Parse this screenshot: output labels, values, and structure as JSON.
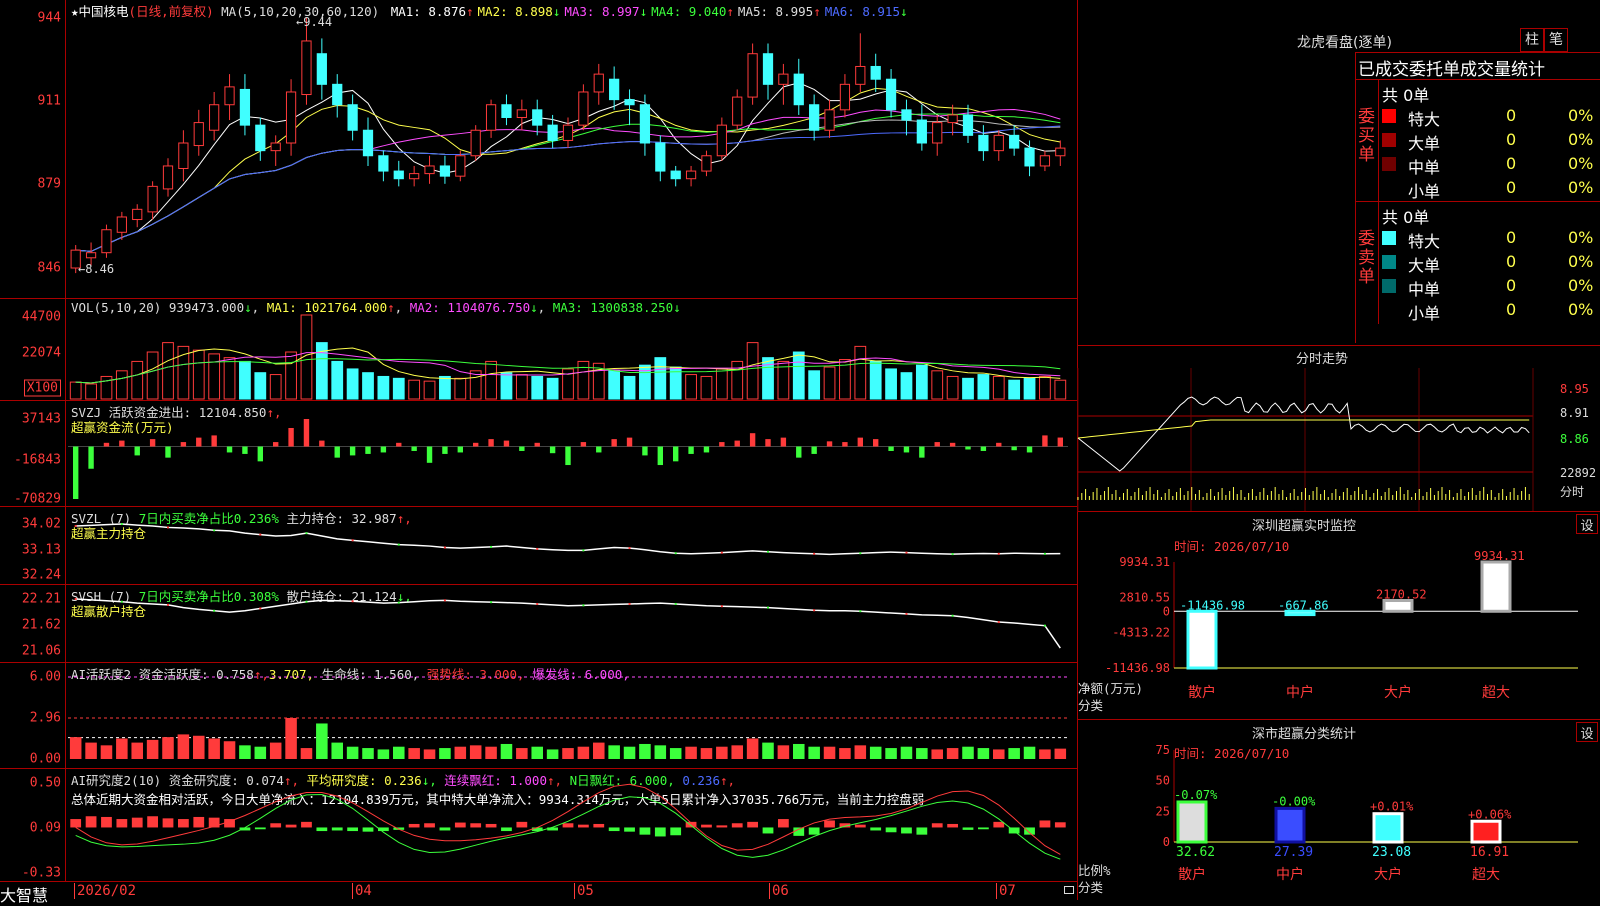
{
  "app_logo": "大智慧",
  "stock": {
    "star": "★",
    "name": "中国核电",
    "mode": "(日线,前复权)"
  },
  "main_panel": {
    "ma_title": "MA(5,10,20,30,60,120)",
    "ma_items": [
      {
        "label": "MA1:",
        "value": "8.876",
        "arrow": "↑",
        "color": "#ffffff"
      },
      {
        "label": "MA2:",
        "value": "8.898",
        "arrow": "↓",
        "color": "#ffff4d"
      },
      {
        "label": "MA3:",
        "value": "8.997",
        "arrow": "↓",
        "color": "#ff4dff"
      },
      {
        "label": "MA4:",
        "value": "9.040",
        "arrow": "↑",
        "color": "#3cff3c"
      },
      {
        "label": "MA5:",
        "value": "8.995",
        "arrow": "↑",
        "color": "#dddddd"
      },
      {
        "label": "MA6:",
        "value": "8.915",
        "arrow": "↓",
        "color": "#4d6bff"
      }
    ],
    "y_ticks": [
      "944",
      "911",
      "879",
      "846"
    ],
    "high_marker": "9.44",
    "low_marker": "8.46"
  },
  "vol_panel": {
    "title": "VOL(5,10,20)",
    "value": "939473.000",
    "value_arrow": "↓",
    "ma1": "MA1: 1021764.000",
    "ma1_arrow": "↑",
    "ma2": "MA2: 1104076.750",
    "ma2_arrow": "↓",
    "ma3": "MA3: 1300838.250",
    "ma3_arrow": "↓",
    "y_ticks": [
      "44700",
      "22074",
      "X100"
    ]
  },
  "svzj_panel": {
    "title": "SVZJ",
    "label": "活跃资金进出:",
    "value": "12104.850",
    "arrow": "↑,",
    "sub": "超赢资金流(万元)",
    "y_ticks": [
      "37143",
      "-16843",
      "-70829"
    ]
  },
  "svzl_panel": {
    "title": "SVZL (7)",
    "ratio_label": "7日内买卖净占比0.236%",
    "hold_label": "主力持仓:",
    "hold_value": "32.987",
    "arrow": "↑,",
    "sub": "超赢主力持仓",
    "y_ticks": [
      "34.02",
      "33.13",
      "32.24"
    ]
  },
  "svsh_panel": {
    "title": "SVSH (7)",
    "ratio_label": "7日内买卖净占比0.308%",
    "hold_label": "散户持仓:",
    "hold_value": "21.124",
    "arrow": "↓,",
    "sub": "超赢散户持仓",
    "y_ticks": [
      "22.21",
      "21.62",
      "21.06"
    ]
  },
  "ai_active_panel": {
    "title": "AI活跃度2",
    "label": "资金活跃度:",
    "value": "0.758",
    "arrow": "↑,",
    "v2": "3.707,",
    "life": "生命线: 1.560,",
    "strong": "强势线: 3.000,",
    "burst": "爆发线: 6.000,",
    "y_ticks": [
      "6.00",
      "2.96",
      "0.00"
    ]
  },
  "ai_research_panel": {
    "title": "AI研究度2(10)",
    "label": "资金研究度:",
    "value": "0.074",
    "arrow": "↑,",
    "avg": "平均研究度: 0.236",
    "avg_arrow": "↓,",
    "red_cnt": "连续飘红: 1.000",
    "red_arrow": "↑,",
    "nday": "N日飘红: 6.000,",
    "last": "0.236",
    "last_arrow": "↑,",
    "summary": "总体近期大资金相对活跃，今日大单净流入：12104.839万元，其中特大单净流入：9934.314万元，大单5日累计净入37035.766万元，当前主力控盘弱",
    "y_ticks": [
      "0.50",
      "0.09",
      "-0.33"
    ]
  },
  "x_axis": [
    "2026/02",
    "04",
    "05",
    "06",
    "07"
  ],
  "longhu": {
    "title": "龙虎看盘(逐单)",
    "btn1": "柱",
    "btn2": "笔",
    "subtitle": "已成交委托单成交量统计",
    "buy_label": "委买单",
    "sell_label": "委卖单",
    "buy_total": "共 0单",
    "sell_total": "共 0单",
    "buy_rows": [
      {
        "name": "特大",
        "count": "0",
        "pct": "0%",
        "color": "#ff0000"
      },
      {
        "name": "大单",
        "count": "0",
        "pct": "0%",
        "color": "#a00000"
      },
      {
        "name": "中单",
        "count": "0",
        "pct": "0%",
        "color": "#700000"
      },
      {
        "name": "小单",
        "count": "0",
        "pct": "0%",
        "color": "#000000"
      }
    ],
    "sell_rows": [
      {
        "name": "特大",
        "count": "0",
        "pct": "0%",
        "color": "#40ffff"
      },
      {
        "name": "大单",
        "count": "0",
        "pct": "0%",
        "color": "#008888"
      },
      {
        "name": "中单",
        "count": "0",
        "pct": "0%",
        "color": "#006a6a"
      },
      {
        "name": "小单",
        "count": "0",
        "pct": "0%",
        "color": "#000000"
      }
    ]
  },
  "intraday": {
    "title": "分时走势",
    "y_ticks": [
      "8.95",
      "8.91",
      "8.86"
    ],
    "vol_max": "22892",
    "vol_unit": "分时"
  },
  "monitor": {
    "title": "深圳超赢实时监控",
    "btn": "设",
    "time": "时间: 2026/07/10",
    "y_ticks": [
      "9934.31",
      "2810.55",
      "0",
      "-4313.22",
      "-11436.98"
    ],
    "unit": "净额(万元)",
    "cat_label": "分类",
    "categories": [
      "散户",
      "中户",
      "大户",
      "超大"
    ]
  },
  "classify": {
    "title": "深市超赢分类统计",
    "btn": "设",
    "time": "时间: 2026/07/10",
    "y_ticks": [
      "75",
      "50",
      "25",
      "0"
    ],
    "unit": "比例%",
    "cat_label": "分类",
    "categories": [
      "散户",
      "中户",
      "大户",
      "超大"
    ]
  },
  "chart_data": [
    {
      "type": "candlestick",
      "title": "中国核电 (日线,前复权)",
      "ylim": [
        8.46,
        9.44
      ],
      "y_ticks": [
        9.44,
        9.11,
        8.79,
        8.46
      ],
      "x_ticks": [
        "2026/02",
        "04",
        "05",
        "06",
        "07"
      ],
      "ohlc": [
        [
          8.46,
          8.55,
          8.44,
          8.53
        ],
        [
          8.5,
          8.56,
          8.47,
          8.52
        ],
        [
          8.52,
          8.63,
          8.5,
          8.61
        ],
        [
          8.6,
          8.68,
          8.57,
          8.66
        ],
        [
          8.65,
          8.71,
          8.62,
          8.69
        ],
        [
          8.68,
          8.8,
          8.65,
          8.78
        ],
        [
          8.77,
          8.89,
          8.74,
          8.86
        ],
        [
          8.85,
          9.0,
          8.8,
          8.95
        ],
        [
          8.94,
          9.08,
          8.9,
          9.03
        ],
        [
          9.0,
          9.15,
          8.96,
          9.1
        ],
        [
          9.1,
          9.22,
          9.04,
          9.17
        ],
        [
          9.16,
          9.22,
          8.98,
          9.02
        ],
        [
          9.02,
          9.05,
          8.88,
          8.92
        ],
        [
          8.92,
          8.98,
          8.86,
          8.95
        ],
        [
          8.95,
          9.2,
          8.9,
          9.15
        ],
        [
          9.14,
          9.44,
          9.1,
          9.35
        ],
        [
          9.3,
          9.36,
          9.12,
          9.18
        ],
        [
          9.18,
          9.22,
          9.05,
          9.1
        ],
        [
          9.1,
          9.14,
          8.96,
          9.0
        ],
        [
          9.0,
          9.05,
          8.86,
          8.9
        ],
        [
          8.9,
          8.92,
          8.8,
          8.84
        ],
        [
          8.84,
          8.88,
          8.78,
          8.81
        ],
        [
          8.81,
          8.86,
          8.78,
          8.83
        ],
        [
          8.83,
          8.9,
          8.79,
          8.86
        ],
        [
          8.86,
          8.9,
          8.79,
          8.82
        ],
        [
          8.82,
          8.92,
          8.8,
          8.9
        ],
        [
          8.9,
          9.02,
          8.88,
          9.0
        ],
        [
          9.0,
          9.12,
          8.97,
          9.1
        ],
        [
          9.1,
          9.14,
          9.02,
          9.05
        ],
        [
          9.05,
          9.12,
          9.0,
          9.08
        ],
        [
          9.08,
          9.12,
          8.98,
          9.02
        ],
        [
          9.02,
          9.06,
          8.93,
          8.96
        ],
        [
          8.96,
          9.05,
          8.93,
          9.02
        ],
        [
          9.02,
          9.18,
          9.0,
          9.15
        ],
        [
          9.15,
          9.26,
          9.1,
          9.22
        ],
        [
          9.2,
          9.25,
          9.08,
          9.12
        ],
        [
          9.12,
          9.16,
          9.02,
          9.1
        ],
        [
          9.1,
          9.14,
          8.9,
          8.95
        ],
        [
          8.95,
          8.98,
          8.8,
          8.84
        ],
        [
          8.84,
          8.86,
          8.78,
          8.81
        ],
        [
          8.81,
          8.86,
          8.78,
          8.84
        ],
        [
          8.84,
          8.92,
          8.82,
          8.9
        ],
        [
          8.9,
          9.05,
          8.88,
          9.02
        ],
        [
          9.02,
          9.16,
          9.0,
          9.13
        ],
        [
          9.13,
          9.34,
          9.1,
          9.3
        ],
        [
          9.3,
          9.34,
          9.12,
          9.18
        ],
        [
          9.18,
          9.26,
          9.1,
          9.22
        ],
        [
          9.22,
          9.28,
          9.06,
          9.1
        ],
        [
          9.1,
          9.14,
          8.96,
          9.0
        ],
        [
          9.0,
          9.12,
          8.97,
          9.08
        ],
        [
          9.08,
          9.22,
          9.05,
          9.18
        ],
        [
          9.18,
          9.38,
          9.15,
          9.25
        ],
        [
          9.25,
          9.3,
          9.15,
          9.2
        ],
        [
          9.2,
          9.24,
          9.05,
          9.08
        ],
        [
          9.08,
          9.12,
          8.98,
          9.04
        ],
        [
          9.04,
          9.1,
          8.92,
          8.95
        ],
        [
          8.95,
          9.06,
          8.9,
          9.03
        ],
        [
          9.03,
          9.1,
          8.98,
          9.06
        ],
        [
          9.06,
          9.1,
          8.95,
          8.98
        ],
        [
          8.98,
          9.02,
          8.88,
          8.92
        ],
        [
          8.92,
          9.0,
          8.88,
          8.98
        ],
        [
          8.98,
          9.02,
          8.9,
          8.93
        ],
        [
          8.93,
          8.96,
          8.82,
          8.86
        ],
        [
          8.86,
          8.92,
          8.84,
          8.9
        ],
        [
          8.9,
          8.96,
          8.86,
          8.93
        ]
      ]
    },
    {
      "type": "bar",
      "title": "VOL(5,10,20)",
      "ylim": [
        0,
        44700
      ],
      "y_ticks": [
        44700,
        22074
      ],
      "unit": "X100",
      "values": [
        9000,
        8000,
        12000,
        15000,
        20000,
        25000,
        30000,
        28000,
        26000,
        24000,
        22000,
        20000,
        14000,
        13000,
        25000,
        44700,
        30000,
        20000,
        16000,
        14000,
        12000,
        11000,
        10000,
        9500,
        12000,
        11000,
        15000,
        20000,
        14000,
        13000,
        12000,
        11000,
        16000,
        20000,
        19000,
        15000,
        12000,
        18000,
        22000,
        17000,
        13000,
        12000,
        16000,
        20000,
        30000,
        22000,
        20000,
        25000,
        15000,
        17000,
        21000,
        28000,
        20000,
        16000,
        14000,
        18000,
        15000,
        12000,
        11000,
        13000,
        12000,
        10000,
        11000,
        12000,
        10000
      ]
    },
    {
      "type": "bar",
      "title": "SVZJ 活跃资金进出",
      "ylim": [
        -70829,
        37143
      ],
      "y_ticks": [
        37143,
        -16843,
        -70829
      ],
      "ylabel": "超赢资金流(万元)",
      "values": [
        -70829,
        -30000,
        5000,
        8000,
        -12000,
        10000,
        -15000,
        6000,
        12000,
        15000,
        -8000,
        -10000,
        -20000,
        6000,
        25000,
        37143,
        8000,
        -15000,
        -12000,
        -10000,
        -8000,
        5000,
        -6000,
        -22000,
        -10000,
        -8000,
        5000,
        10000,
        8000,
        -6000,
        5000,
        -9000,
        -25000,
        6000,
        -8000,
        10000,
        12000,
        -12000,
        -25000,
        -20000,
        -10000,
        -8000,
        6000,
        8000,
        18000,
        10000,
        12000,
        -15000,
        -10000,
        7000,
        6000,
        12000,
        10000,
        -6000,
        -8000,
        -15000,
        6000,
        5000,
        -4000,
        -6000,
        5000,
        -5000,
        -8000,
        15000,
        12104
      ]
    },
    {
      "type": "line",
      "title": "SVZL 主力持仓",
      "ylim": [
        32.24,
        34.02
      ],
      "y_ticks": [
        34.02,
        33.13,
        32.24
      ],
      "ylabel": "超赢主力持仓",
      "values": [
        33.95,
        33.97,
        34.0,
        34.02,
        33.98,
        33.95,
        33.9,
        33.88,
        33.85,
        33.8,
        33.78,
        33.7,
        33.65,
        33.6,
        33.62,
        33.7,
        33.6,
        33.5,
        33.45,
        33.4,
        33.35,
        33.3,
        33.28,
        33.25,
        33.2,
        33.18,
        33.2,
        33.22,
        33.25,
        33.2,
        33.15,
        33.12,
        33.1,
        33.1,
        33.15,
        33.2,
        33.18,
        33.12,
        33.05,
        33.0,
        32.98,
        33.0,
        33.02,
        33.05,
        33.08,
        33.05,
        33.02,
        33.0,
        32.98,
        32.96,
        32.98,
        33.0,
        33.02,
        33.04,
        33.02,
        33.0,
        32.98,
        32.97,
        32.98,
        32.99,
        32.98,
        33.0,
        32.99,
        32.98,
        32.987
      ]
    },
    {
      "type": "line",
      "title": "SVSH 散户持仓",
      "ylim": [
        21.06,
        22.21
      ],
      "y_ticks": [
        22.21,
        21.62,
        21.06
      ],
      "ylabel": "超赢散户持仓",
      "values": [
        22.21,
        22.19,
        22.17,
        22.15,
        22.12,
        22.1,
        22.08,
        22.02,
        21.98,
        21.95,
        21.92,
        21.95,
        22.0,
        22.05,
        22.1,
        22.15,
        22.18,
        22.17,
        22.16,
        22.14,
        22.12,
        22.13,
        22.15,
        22.17,
        22.18,
        22.16,
        22.15,
        22.14,
        22.13,
        22.12,
        22.1,
        22.08,
        22.06,
        22.07,
        22.08,
        22.09,
        22.1,
        22.11,
        22.12,
        22.1,
        22.08,
        22.06,
        22.05,
        22.04,
        22.03,
        22.02,
        22.0,
        21.98,
        21.96,
        21.95,
        21.95,
        21.94,
        21.92,
        21.9,
        21.88,
        21.86,
        21.85,
        21.84,
        21.8,
        21.75,
        21.7,
        21.68,
        21.65,
        21.62,
        21.124
      ]
    },
    {
      "type": "bar",
      "title": "AI活跃度2",
      "ylim": [
        0,
        6
      ],
      "y_ticks": [
        6.0,
        2.96,
        0.0
      ],
      "reference_lines": {
        "生命线": 1.56,
        "强势线": 3.0,
        "爆发线": 6.0
      },
      "values": [
        1.6,
        1.2,
        1.0,
        1.5,
        1.2,
        1.4,
        1.6,
        1.8,
        1.7,
        1.5,
        1.3,
        1.0,
        0.9,
        1.2,
        3.0,
        0.8,
        2.6,
        1.2,
        0.9,
        0.8,
        0.7,
        0.9,
        0.8,
        0.7,
        0.8,
        0.9,
        1.0,
        0.9,
        1.1,
        0.8,
        0.9,
        0.7,
        0.8,
        0.9,
        1.2,
        1.0,
        0.9,
        1.1,
        1.0,
        0.8,
        0.9,
        0.8,
        0.9,
        1.0,
        1.5,
        1.2,
        1.0,
        1.1,
        0.9,
        0.9,
        0.8,
        1.0,
        0.9,
        0.8,
        0.9,
        0.8,
        0.7,
        0.8,
        0.9,
        0.8,
        0.7,
        0.8,
        0.9,
        0.7,
        0.758
      ]
    },
    {
      "type": "bar",
      "title": "AI研究度2(10)",
      "ylim": [
        -0.33,
        0.5
      ],
      "y_ticks": [
        0.5,
        0.09,
        -0.33
      ],
      "values": [
        0.12,
        0.16,
        0.15,
        0.12,
        0.14,
        0.16,
        0.13,
        0.12,
        0.15,
        0.14,
        0.12,
        0.05,
        0.03,
        0.06,
        0.04,
        0.08,
        0.06,
        0.05,
        0.06,
        0.07,
        0.06,
        0.04,
        0.05,
        0.06,
        0.05,
        0.07,
        0.06,
        0.05,
        0.06,
        0.08,
        0.06,
        0.05,
        0.06,
        0.04,
        0.05,
        0.06,
        0.07,
        0.12,
        0.15,
        0.13,
        0.08,
        0.04,
        0.03,
        0.06,
        0.08,
        0.1,
        0.12,
        0.14,
        0.12,
        0.1,
        0.06,
        0.04,
        0.05,
        0.08,
        0.1,
        0.12,
        0.06,
        0.05,
        0.04,
        0.03,
        0.08,
        0.1,
        0.12,
        0.1,
        0.074
      ]
    },
    {
      "type": "bar",
      "title": "深圳超赢实时监控",
      "categories": [
        "散户",
        "中户",
        "大户",
        "超大"
      ],
      "values": [
        -11436.98,
        -667.86,
        2170.52,
        9934.31
      ],
      "ylim": [
        -11436.98,
        9934.31
      ],
      "y_ticks": [
        9934.31,
        2810.55,
        0,
        -4313.22,
        -11436.98
      ],
      "ylabel": "净额(万元)",
      "xlabel": "分类"
    },
    {
      "type": "bar",
      "title": "深市超赢分类统计",
      "categories": [
        "散户",
        "中户",
        "大户",
        "超大"
      ],
      "values": [
        32.62,
        27.39,
        23.08,
        16.91
      ],
      "changes": [
        "-0.07%",
        "-0.00%",
        "+0.01%",
        "+0.06%"
      ],
      "ylim": [
        0,
        75
      ],
      "y_ticks": [
        75,
        50,
        25,
        0
      ],
      "ylabel": "比例%",
      "xlabel": "分类"
    }
  ]
}
